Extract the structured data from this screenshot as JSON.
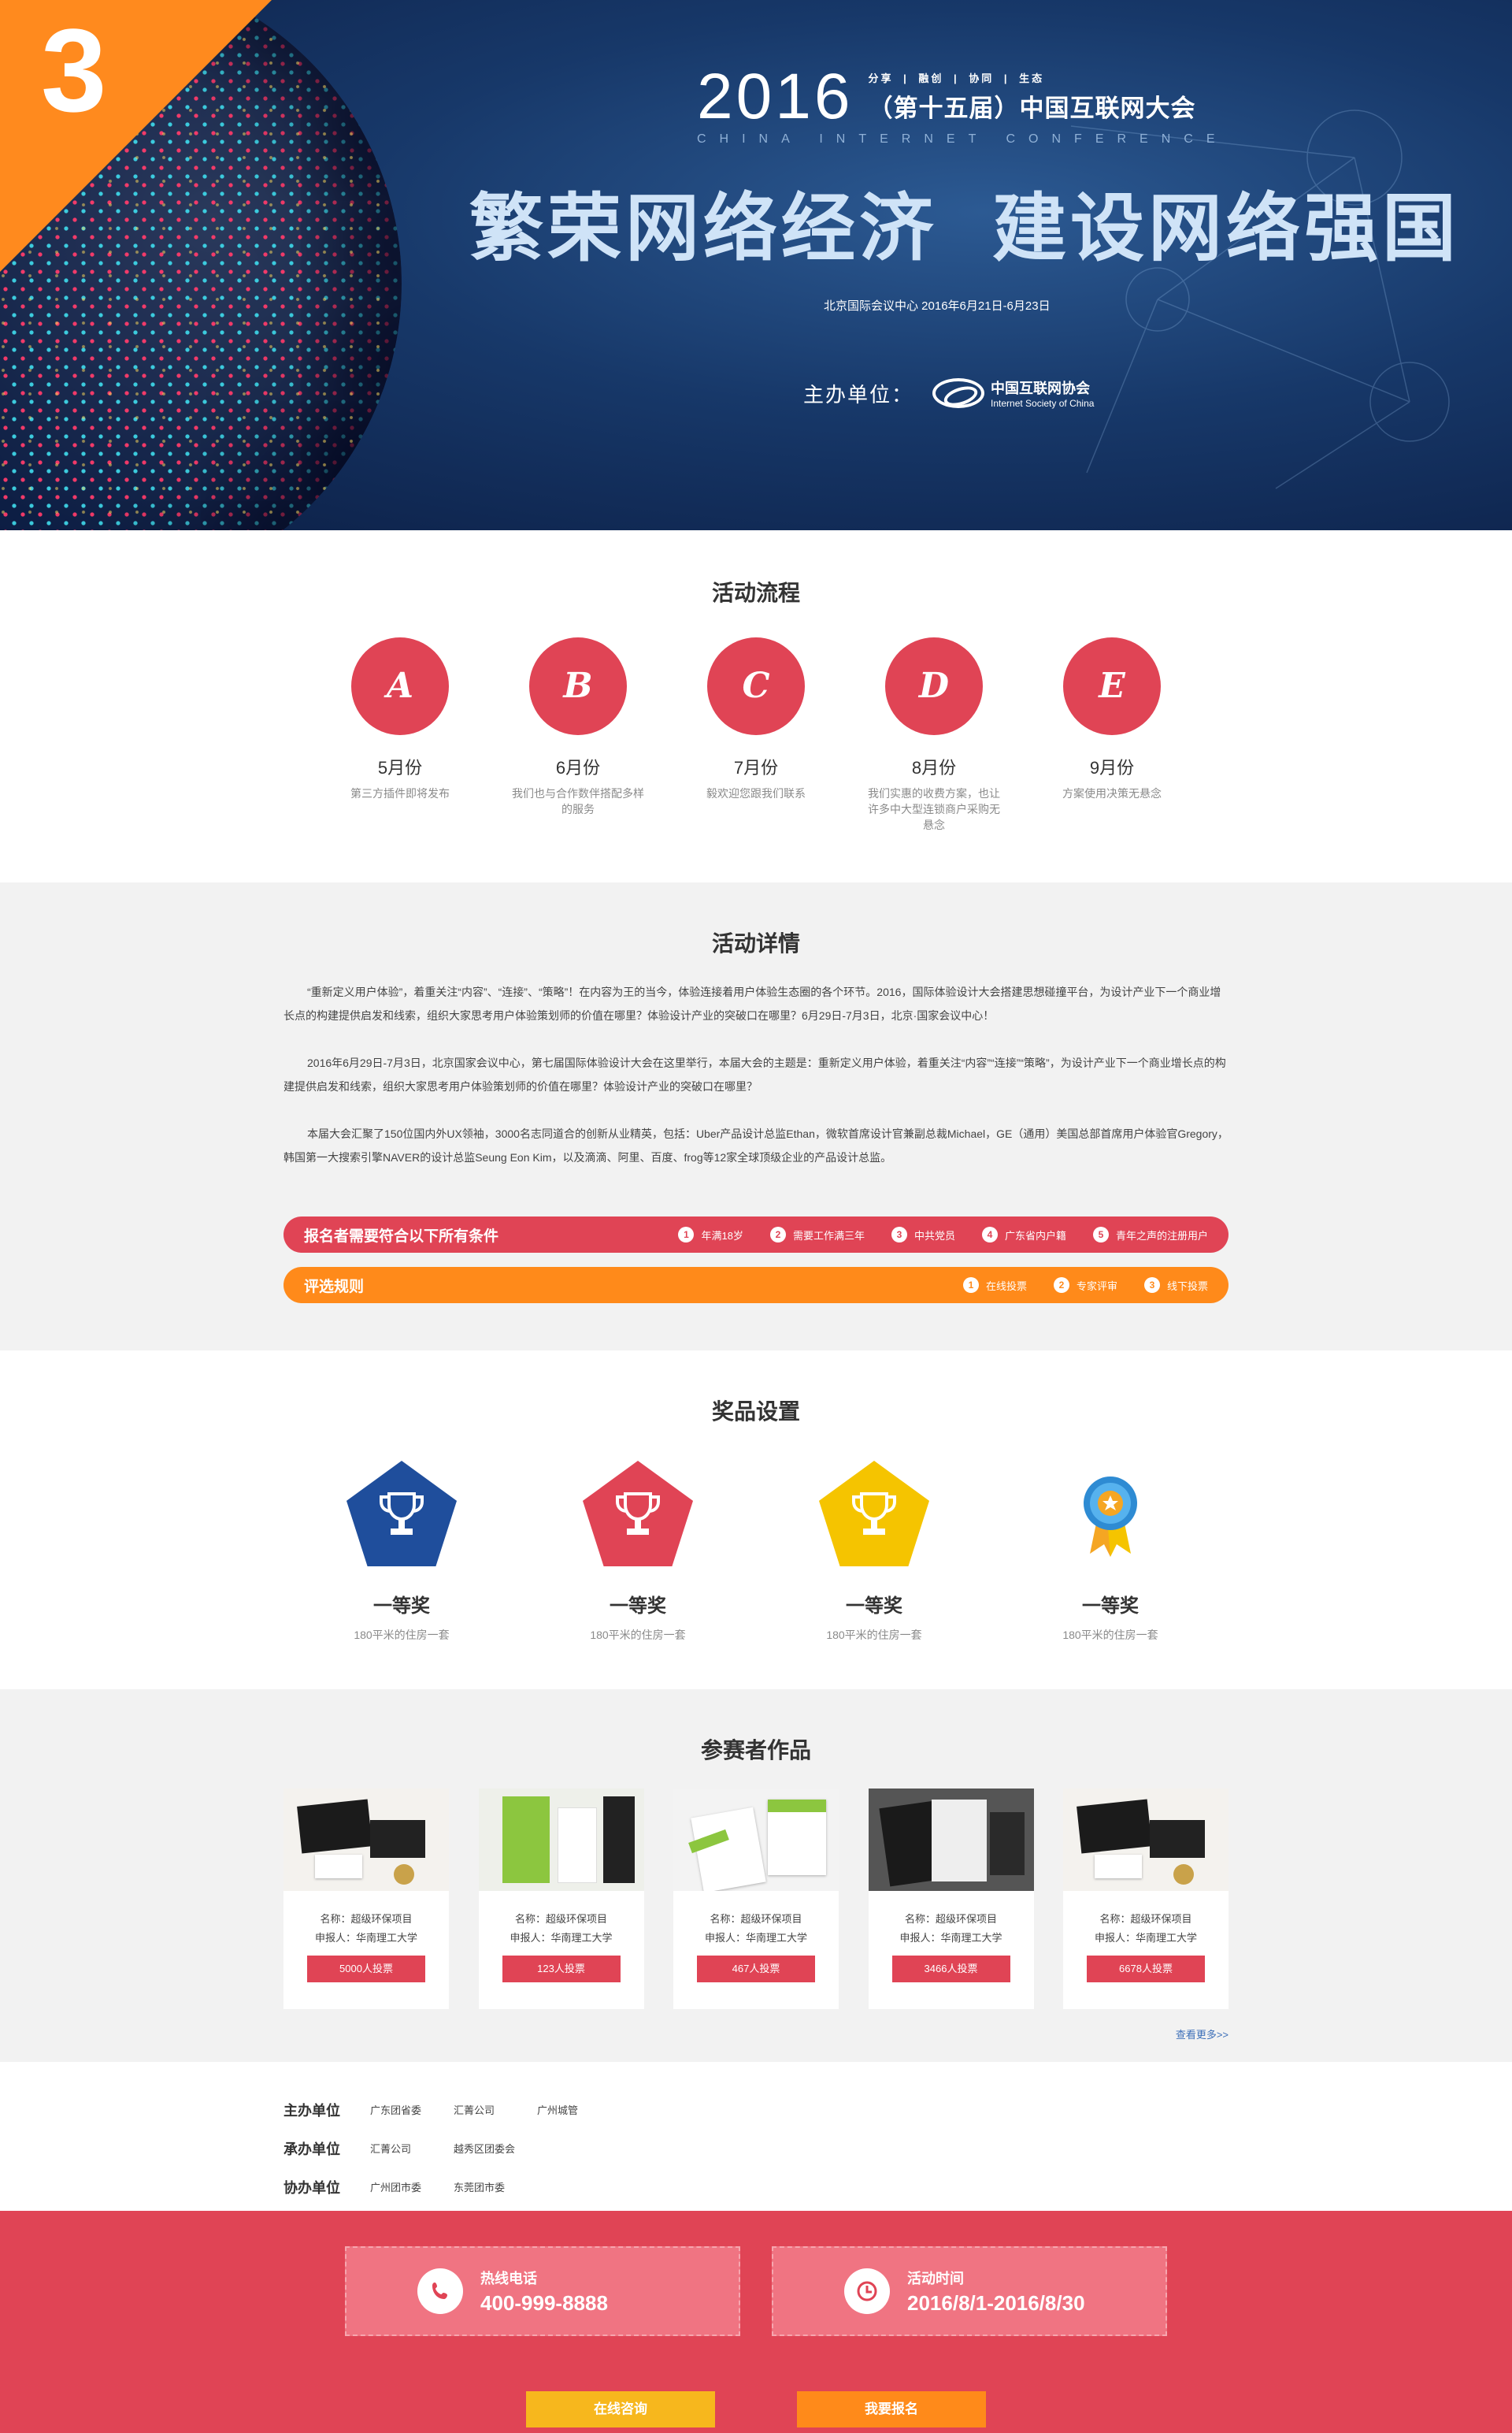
{
  "hero": {
    "corner_number": "3",
    "year": "2016",
    "tags": "分享 | 融创 | 协同 | 生态",
    "conference_name": "（第十五届）中国互联网大会",
    "conference_en": "CHINA INTERNET CONFERENCE",
    "slogan_left": "繁荣网络经济",
    "slogan_right": "建设网络强国",
    "venue_date": "北京国际会议中心  2016年6月21日-6月23日",
    "host_label": "主办单位：",
    "host_name_cn": "中国互联网协会",
    "host_name_en": "Internet Society of China"
  },
  "process": {
    "title": "活动流程",
    "steps": [
      {
        "letter": "A",
        "month": "5月份",
        "desc": "第三方插件即将发布"
      },
      {
        "letter": "B",
        "month": "6月份",
        "desc": "我们也与合作数伴搭配多样的服务"
      },
      {
        "letter": "C",
        "month": "7月份",
        "desc": "毅欢迎您跟我们联系"
      },
      {
        "letter": "D",
        "month": "8月份",
        "desc": "我们实惠的收费方案，也让许多中大型连锁商户采购无悬念"
      },
      {
        "letter": "E",
        "month": "9月份",
        "desc": "方案使用决策无悬念"
      }
    ]
  },
  "details": {
    "title": "活动详情",
    "paragraphs": [
      "“重新定义用户体验”，着重关注“内容”、“连接”、“策略”！在内容为王的当今，体验连接着用户体验生态圈的各个环节。2016，国际体验设计大会搭建思想碰撞平台，为设计产业下一个商业增长点的构建提供启发和线索，组织大家思考用户体验策划师的价值在哪里？体验设计产业的突破口在哪里？6月29日-7月3日，北京·国家会议中心！",
      "2016年6月29日-7月3日，北京国家会议中心，第七届国际体验设计大会在这里举行，本届大会的主题是：重新定义用户体验，着重关注“内容”“连接”“策略”，为设计产业下一个商业增长点的构建提供启发和线索，组织大家思考用户体验策划师的价值在哪里？体验设计产业的突破口在哪里？",
      "本届大会汇聚了150位国内外UX领袖，3000名志同道合的创新从业精英，包括：Uber产品设计总监Ethan，微软首席设计官兼副总裁Michael，GE（通用）美国总部首席用户体验官Gregory，韩国第一大搜索引擎NAVER的设计总监Seung Eon Kim，以及滴滴、阿里、百度、frog等12家全球顶级企业的产品设计总监。"
    ],
    "requirements": {
      "title": "报名者需要符合以下所有条件",
      "items": [
        {
          "n": "1",
          "text": "年满18岁"
        },
        {
          "n": "2",
          "text": "需要工作满三年"
        },
        {
          "n": "3",
          "text": "中共党员"
        },
        {
          "n": "4",
          "text": "广东省内户籍"
        },
        {
          "n": "5",
          "text": "青年之声的注册用户"
        }
      ]
    },
    "rules": {
      "title": "评选规则",
      "items": [
        {
          "n": "1",
          "text": "在线投票"
        },
        {
          "n": "2",
          "text": "专家评审"
        },
        {
          "n": "3",
          "text": "线下投票"
        }
      ]
    }
  },
  "prizes": {
    "title": "奖品设置",
    "items": [
      {
        "name": "一等奖",
        "desc": "180平米的住房一套",
        "color": "#1f4e9c",
        "icon": "trophy-icon"
      },
      {
        "name": "一等奖",
        "desc": "180平米的住房一套",
        "color": "#e04455",
        "icon": "trophy-icon"
      },
      {
        "name": "一等奖",
        "desc": "180平米的住房一套",
        "color": "#f5c400",
        "icon": "trophy-icon"
      },
      {
        "name": "一等奖",
        "desc": "180平米的住房一套",
        "color": "#2e8bd3",
        "icon": "medal-icon"
      }
    ]
  },
  "works": {
    "title": "参赛者作品",
    "name_label": "名称：超级环保项目",
    "applicant_label": "申报人：华南理工大学",
    "items": [
      {
        "name": "名称：超级环保项目",
        "applicant": "申报人：华南理工大学",
        "votes": "5000人投票"
      },
      {
        "name": "名称：超级环保项目",
        "applicant": "申报人：华南理工大学",
        "votes": "123人投票"
      },
      {
        "name": "名称：超级环保项目",
        "applicant": "申报人：华南理工大学",
        "votes": "467人投票"
      },
      {
        "name": "名称：超级环保项目",
        "applicant": "申报人：华南理工大学",
        "votes": "3466人投票"
      },
      {
        "name": "名称：超级环保项目",
        "applicant": "申报人：华南理工大学",
        "votes": "6678人投票"
      }
    ],
    "more": "查看更多>>"
  },
  "orgs": {
    "rows": [
      {
        "label": "主办单位",
        "values": [
          "广东团省委",
          "汇菁公司",
          "广州城管"
        ]
      },
      {
        "label": "承办单位",
        "values": [
          "汇菁公司",
          "越秀区团委会"
        ]
      },
      {
        "label": "协办单位",
        "values": [
          "广州团市委",
          "东莞团市委"
        ]
      }
    ]
  },
  "footer": {
    "hotline_label": "热线电话",
    "hotline_value": "400-999-8888",
    "time_label": "活动时间",
    "time_value": "2016/8/1-2016/8/30",
    "consult_button": "在线咨询",
    "signup_button": "我要报名"
  }
}
